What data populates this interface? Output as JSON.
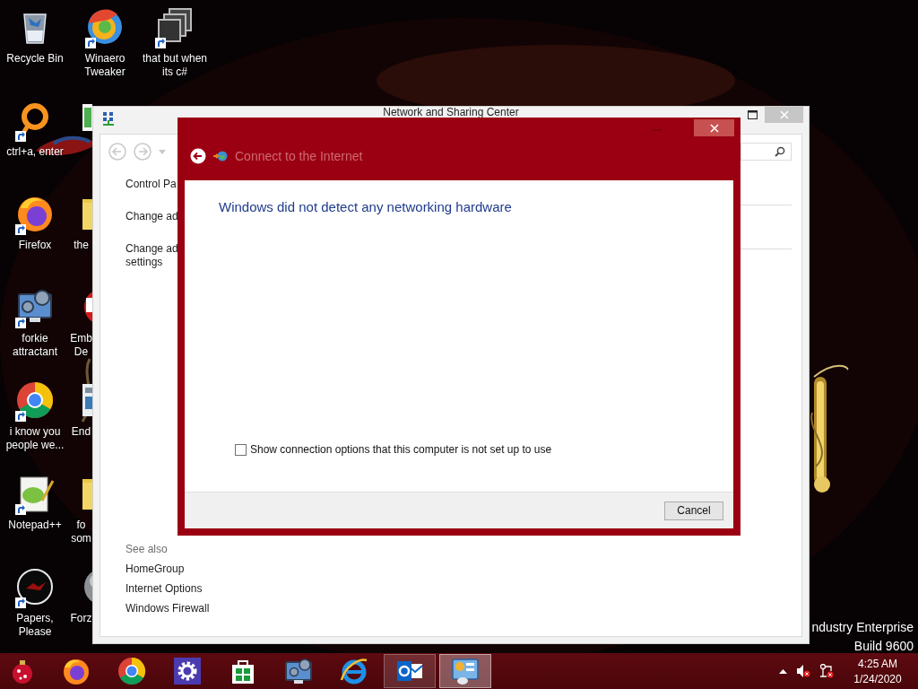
{
  "desktop": {
    "icon_columns": [
      [
        {
          "label": "Recycle Bin",
          "kind": "recycle-bin",
          "shortcut": false
        },
        {
          "label": "ctrl+a, enter",
          "kind": "ring",
          "shortcut": true
        },
        {
          "label": "Firefox",
          "kind": "firefox",
          "shortcut": true
        },
        {
          "label": "forkie attractant",
          "kind": "monitor-gear",
          "shortcut": true
        },
        {
          "label": "i know you people we...",
          "kind": "chrome",
          "shortcut": true
        },
        {
          "label": "Notepad++",
          "kind": "notepad",
          "shortcut": true
        },
        {
          "label": "Papers, Please",
          "kind": "disc",
          "shortcut": true
        }
      ],
      [
        {
          "label": "Winaero Tweaker",
          "kind": "swirl",
          "shortcut": true
        },
        {
          "kind": "sheet"
        },
        {
          "label": "the",
          "kind": "folder"
        },
        {
          "label": "Emb De",
          "kind": "red-app"
        },
        {
          "label": "End",
          "kind": "doc"
        },
        {
          "label": "fo som",
          "kind": "folder"
        },
        {
          "label": "Forz",
          "kind": "sphere"
        }
      ],
      [
        {
          "label": "that but when its c#",
          "kind": "stack",
          "shortcut": true
        }
      ]
    ],
    "edition_lines": [
      "ndustry Enterprise",
      "Build 9600"
    ]
  },
  "window": {
    "title": "Network and Sharing Center",
    "links": [
      {
        "lines": [
          "Control Pa"
        ]
      },
      {
        "lines": [
          "Change ad"
        ]
      },
      {
        "lines": [
          "Change ad",
          "settings"
        ]
      }
    ],
    "see_also_title": "See also",
    "see_also": [
      "HomeGroup",
      "Internet Options",
      "Windows Firewall"
    ]
  },
  "dialog": {
    "title": "Connect to the Internet",
    "heading": "Windows did not detect any networking hardware",
    "option": {
      "label": "Show connection options that this computer is not set up to use",
      "checked": false
    },
    "buttons": [
      "Cancel"
    ]
  },
  "taskbar": {
    "apps": [
      {
        "kind": "ornament",
        "running": false,
        "selected": false
      },
      {
        "kind": "firefox",
        "running": false,
        "selected": false
      },
      {
        "kind": "chrome",
        "running": false,
        "selected": false
      },
      {
        "kind": "settings",
        "running": false,
        "selected": false
      },
      {
        "kind": "store",
        "running": false,
        "selected": false
      },
      {
        "kind": "monitor-gear",
        "running": false,
        "selected": false
      },
      {
        "kind": "ie",
        "running": false,
        "selected": false
      },
      {
        "kind": "outlook",
        "running": true,
        "selected": false
      },
      {
        "kind": "control-panel",
        "running": true,
        "selected": true
      }
    ],
    "clock": {
      "time": "4:25 AM",
      "date": "1/24/2020"
    }
  }
}
